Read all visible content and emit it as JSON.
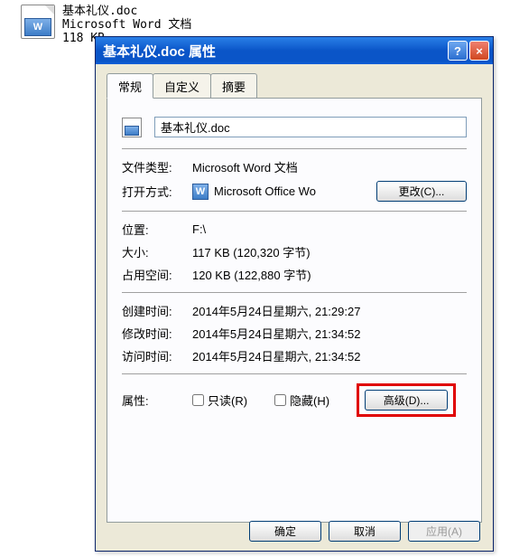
{
  "desktop": {
    "filename": "基本礼仪.doc",
    "type": "Microsoft Word 文档",
    "size": "118 KB",
    "icon_letter": "W"
  },
  "window": {
    "title": "基本礼仪.doc 属性",
    "help": "?",
    "close": "×"
  },
  "tabs": [
    {
      "label": "常规"
    },
    {
      "label": "自定义"
    },
    {
      "label": "摘要"
    }
  ],
  "general": {
    "icon_letter": "W",
    "filename": "基本礼仪.doc",
    "labels": {
      "filetype": "文件类型:",
      "openwith": "打开方式:",
      "location": "位置:",
      "size": "大小:",
      "sizeon": "占用空间:",
      "created": "创建时间:",
      "modified": "修改时间:",
      "accessed": "访问时间:",
      "attrs": "属性:"
    },
    "values": {
      "filetype": "Microsoft Word 文档",
      "openwith_icon": "W",
      "openwith": "Microsoft Office Wo",
      "location": "F:\\",
      "size": "117 KB (120,320 字节)",
      "sizeon": "120 KB (122,880 字节)",
      "created": "2014年5月24日星期六, 21:29:27",
      "modified": "2014年5月24日星期六, 21:34:52",
      "accessed": "2014年5月24日星期六, 21:34:52"
    },
    "buttons": {
      "change": "更改(C)...",
      "advanced": "高级(D)..."
    },
    "checkboxes": {
      "readonly": "只读(R)",
      "hidden": "隐藏(H)"
    }
  },
  "bottom": {
    "ok": "确定",
    "cancel": "取消",
    "apply": "应用(A)"
  }
}
